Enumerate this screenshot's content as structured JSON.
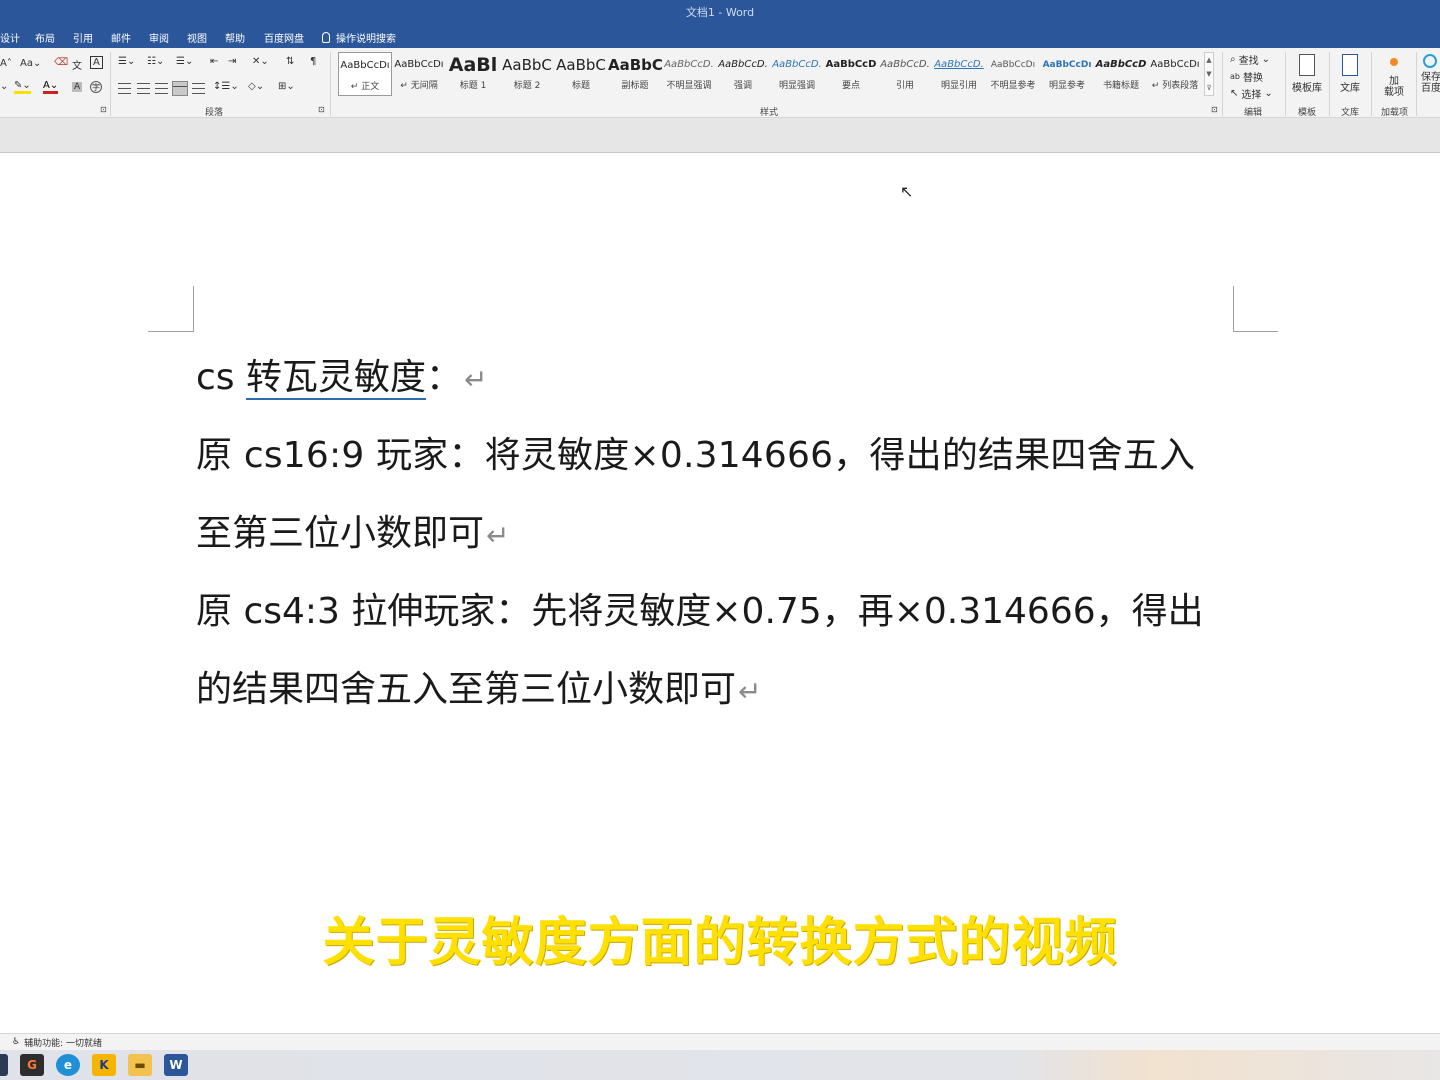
{
  "window": {
    "title": "文档1  -  Word"
  },
  "tabs": {
    "design": "设计",
    "layout": "布局",
    "references": "引用",
    "mailings": "邮件",
    "review": "审阅",
    "view": "视图",
    "help": "帮助",
    "baidu": "百度网盘",
    "tell_me": "操作说明搜索"
  },
  "ribbon": {
    "paragraph_label": "段落",
    "styles_label": "样式",
    "editing_label": "编辑",
    "template_label": "模板",
    "wenku_label": "文库",
    "addins_label": "加载项",
    "styles": [
      {
        "sample": "AaBbCcDı",
        "name": "↵ 正文"
      },
      {
        "sample": "AaBbCcDı",
        "name": "↵ 无间隔"
      },
      {
        "sample": "AaBl",
        "name": "标题 1"
      },
      {
        "sample": "AaBbC",
        "name": "标题 2"
      },
      {
        "sample": "AaBbC",
        "name": "标题"
      },
      {
        "sample": "AaBbC",
        "name": "副标题"
      },
      {
        "sample": "AaBbCcD.",
        "name": "不明显强调"
      },
      {
        "sample": "AaBbCcD.",
        "name": "强调"
      },
      {
        "sample": "AaBbCcD.",
        "name": "明显强调"
      },
      {
        "sample": "AaBbCcD",
        "name": "要点"
      },
      {
        "sample": "AaBbCcD.",
        "name": "引用"
      },
      {
        "sample": "AaBbCcD.",
        "name": "明显引用"
      },
      {
        "sample": "AaBbCcDı",
        "name": "不明显参考"
      },
      {
        "sample": "AaBbCcDı",
        "name": "明显参考"
      },
      {
        "sample": "AaBbCcD",
        "name": "书籍标题"
      },
      {
        "sample": "AaBbCcDı",
        "name": "↵ 列表段落"
      }
    ],
    "find": "查找",
    "replace": "替换",
    "select": "选择",
    "template_lib": "模板库",
    "wenku": "文库",
    "addin_btn": "加载项",
    "addin_btn_line1": "加",
    "addin_btn_line2": "载项",
    "save_baidu_line1": "保存",
    "save_baidu_line2": "百度"
  },
  "document": {
    "line1_prefix": "cs ",
    "line1_underlined": "转瓦灵敏度",
    "line1_suffix": "：",
    "para2_line1": "原  cs16:9  玩家：将灵敏度×0.314666，得出的结果四舍五入",
    "para2_line2": "至第三位小数即可",
    "para3_line1": "原  cs4:3  拉伸玩家：先将灵敏度×0.75，再×0.314666，得出",
    "para3_line2": "的结果四舍五入至第三位小数即可",
    "para_mark": "↵"
  },
  "subtitle": "关于灵敏度方面的转换方式的视频",
  "status": {
    "accessibility": "辅助功能: 一切就绪"
  },
  "colors": {
    "accent": "#2b579a",
    "subtitle": "#ffe000"
  }
}
